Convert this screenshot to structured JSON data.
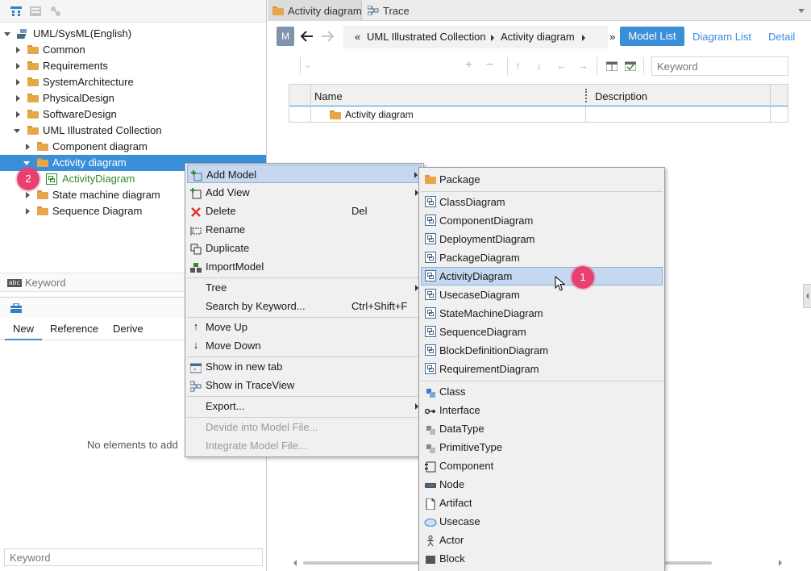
{
  "tabs": [
    {
      "label": "Activity diagram",
      "active": true
    },
    {
      "label": "Trace",
      "active": false
    }
  ],
  "tree": {
    "root": "UML/SysML(English)",
    "items": [
      {
        "label": "Common"
      },
      {
        "label": "Requirements"
      },
      {
        "label": "SystemArchitecture"
      },
      {
        "label": "PhysicalDesign"
      },
      {
        "label": "SoftwareDesign"
      },
      {
        "label": "UML Illustrated Collection"
      },
      {
        "label": "Component diagram"
      },
      {
        "label": "Activity diagram"
      },
      {
        "label": "ActivityDiagram"
      },
      {
        "label": "State machine diagram"
      },
      {
        "label": "Sequence Diagram"
      }
    ],
    "keyword_placeholder": "Keyword"
  },
  "bottom_panel": {
    "tabs": [
      "New",
      "Reference",
      "Derive"
    ],
    "empty_text": "No elements to add",
    "keyword_placeholder": "Keyword"
  },
  "nav": {
    "m_label": "M",
    "breadcrumb_prefix": "«",
    "breadcrumb": [
      "UML Illustrated Collection",
      "Activity diagram"
    ],
    "more": "»",
    "view_buttons": [
      "Model List",
      "Diagram List",
      "Detail"
    ]
  },
  "toolbar": {
    "keyword_placeholder": "Keyword"
  },
  "table": {
    "columns": [
      "Name",
      "Description"
    ],
    "rows": [
      {
        "name": "Activity diagram",
        "description": ""
      }
    ]
  },
  "context_menu": {
    "items": [
      {
        "label": "Add Model",
        "shortcut": ""
      },
      {
        "label": "Add View",
        "shortcut": ""
      },
      {
        "label": "Delete",
        "shortcut": "Del"
      },
      {
        "label": "Rename",
        "shortcut": ""
      },
      {
        "label": "Duplicate",
        "shortcut": ""
      },
      {
        "label": "ImportModel",
        "shortcut": ""
      },
      {
        "label": "Tree",
        "shortcut": ""
      },
      {
        "label": "Search by Keyword...",
        "shortcut": "Ctrl+Shift+F"
      },
      {
        "label": "Move Up",
        "shortcut": ""
      },
      {
        "label": "Move Down",
        "shortcut": ""
      },
      {
        "label": "Show in new tab",
        "shortcut": ""
      },
      {
        "label": "Show in TraceView",
        "shortcut": ""
      },
      {
        "label": "Export...",
        "shortcut": ""
      },
      {
        "label": "Devide into Model File...",
        "shortcut": ""
      },
      {
        "label": "Integrate Model File...",
        "shortcut": ""
      }
    ]
  },
  "submenu": {
    "items": [
      "Package",
      "ClassDiagram",
      "ComponentDiagram",
      "DeploymentDiagram",
      "PackageDiagram",
      "ActivityDiagram",
      "UsecaseDiagram",
      "StateMachineDiagram",
      "SequenceDiagram",
      "BlockDefinitionDiagram",
      "RequirementDiagram",
      "Class",
      "Interface",
      "DataType",
      "PrimitiveType",
      "Component",
      "Node",
      "Artifact",
      "Usecase",
      "Actor",
      "Block"
    ]
  },
  "badges": [
    "1",
    "2"
  ],
  "colors": {
    "accent": "#3b8fd9",
    "badge": "#e8406f",
    "highlight": "#c5d8f0",
    "delete_red": "#d33",
    "new_element_green": "#2f8a2f"
  }
}
